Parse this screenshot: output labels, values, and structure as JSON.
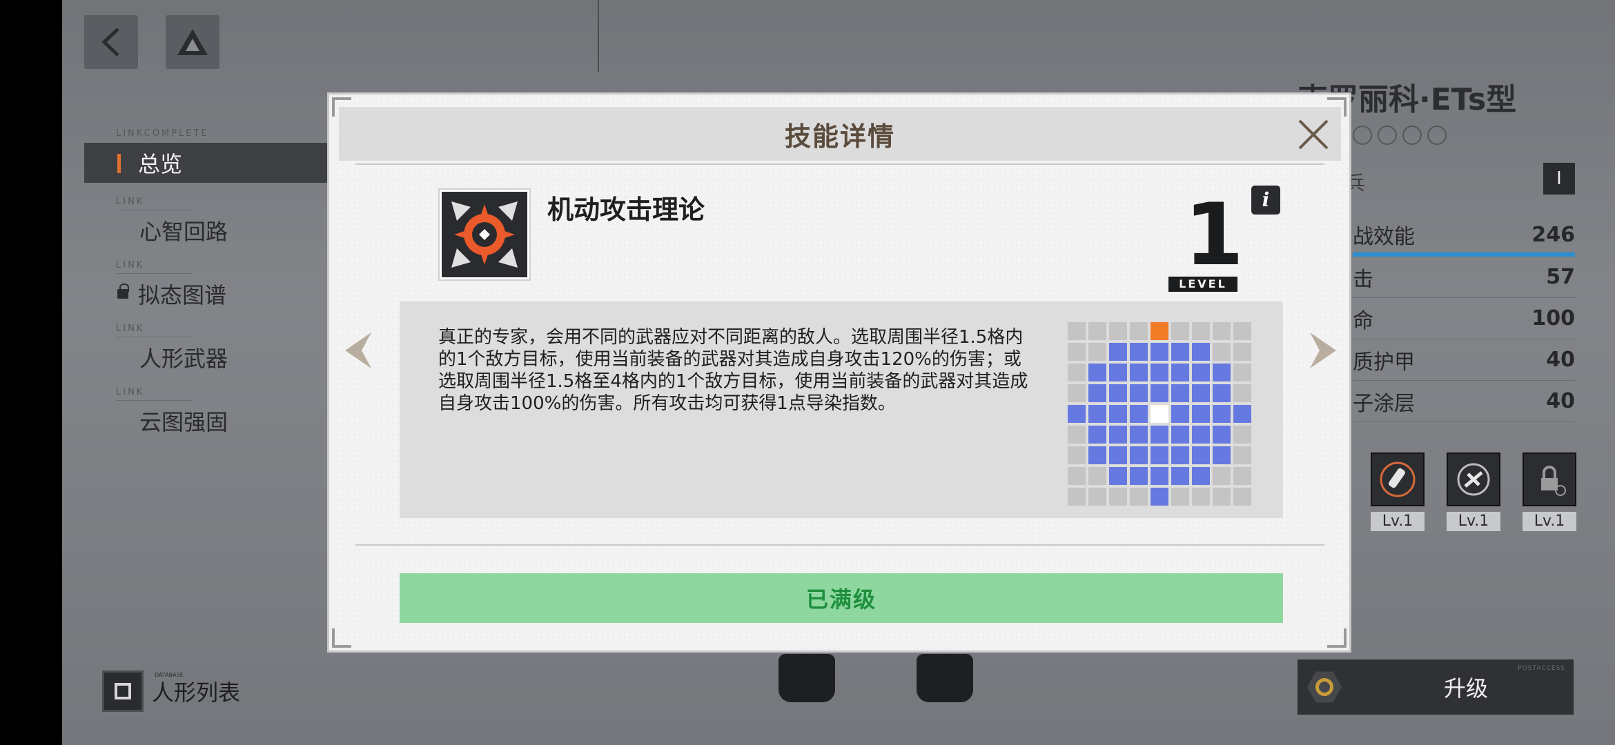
{
  "nav": {
    "active_tag": "LINKCOMPLETE",
    "active_label": "总览",
    "items": [
      {
        "tag": "LINK",
        "label": "心智回路",
        "locked": false
      },
      {
        "tag": "LINK",
        "label": "拟态图谱",
        "locked": true
      },
      {
        "tag": "LINK",
        "label": "人形武器",
        "locked": false
      },
      {
        "tag": "LINK",
        "label": "云图强固",
        "locked": false
      }
    ]
  },
  "doll_list": {
    "label": "人形列表",
    "small_tag": "DATABASE"
  },
  "character": {
    "name": "克罗丽科·ETs型",
    "class": "兵",
    "chip": "I",
    "stats": [
      {
        "label": "战效能",
        "value": "246"
      },
      {
        "label": "击",
        "value": "57"
      },
      {
        "label": "命",
        "value": "100"
      },
      {
        "label": "质护甲",
        "value": "40"
      },
      {
        "label": "子涂层",
        "value": "40"
      }
    ],
    "skills": [
      {
        "level": "Lv.1",
        "icon": "rocket-icon"
      },
      {
        "level": "Lv.1",
        "icon": "chain-icon"
      },
      {
        "level": "Lv.1",
        "icon": "locked-icon"
      }
    ],
    "upgrade_label": "升级",
    "upgrade_tag": "POSTACCESS"
  },
  "modal": {
    "title": "技能详情",
    "skill_name": "机动攻击理论",
    "level": "1",
    "level_label": "LEVEL",
    "info": "i",
    "description": "真正的专家，会用不同的武器应对不同距离的敌人。选取周围半径1.5格内的1个敌方目标，使用当前装备的武器对其造成自身攻击120%的伤害；或选取周围半径1.5格至4格内的1个敌方目标，使用当前装备的武器对其造成自身攻击100%的伤害。所有攻击均可获得1点导染指数。",
    "range_grid": [
      "....o....",
      "..bbbbb..",
      ".bbbbbbb.",
      ".bbbbbbb.",
      "bbbbwbbbb",
      ".bbbbbbb.",
      ".bbbbbbb.",
      "..bbbbb..",
      "....b...."
    ],
    "max_button": "已满级"
  },
  "colors": {
    "accent_orange": "#e07030",
    "range_blue": "#6679e0",
    "range_origin": "#f27c26",
    "max_green": "#8ed8a0",
    "stat_bar": "#2a8fd0"
  }
}
